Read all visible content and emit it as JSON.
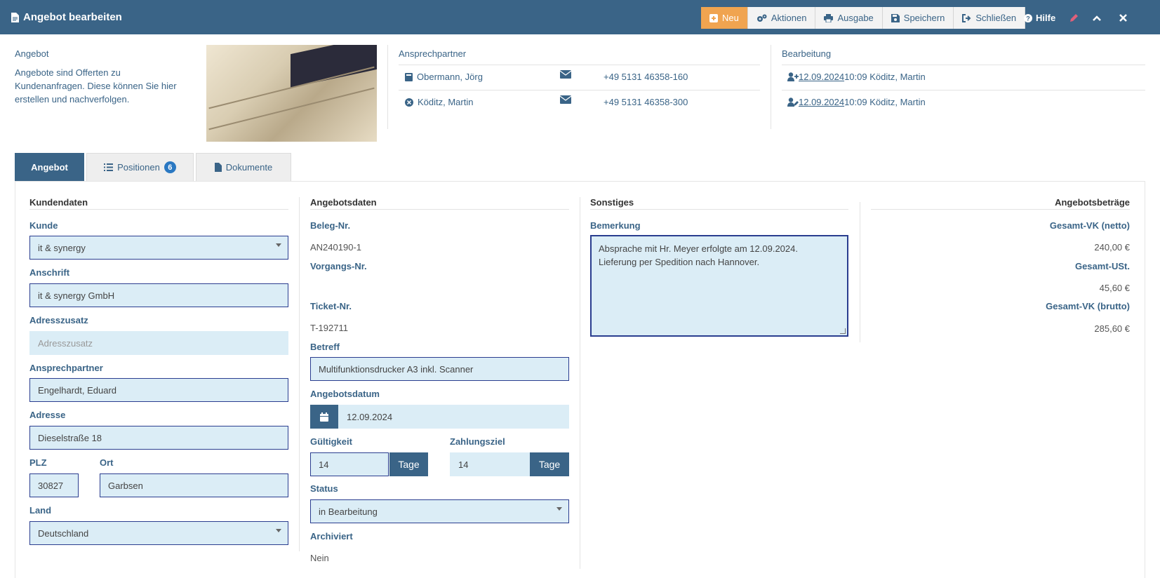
{
  "window": {
    "title": "Angebot bearbeiten"
  },
  "toolbar": {
    "new_label": "Neu",
    "actions_label": "Aktionen",
    "output_label": "Ausgabe",
    "save_label": "Speichern",
    "close_label": "Schließen",
    "help_label": "Hilfe"
  },
  "header": {
    "offer_label": "Angebot",
    "description": "Angebote sind Offerten zu Kundenanfragen. Diese können Sie hier erstellen und nachverfolgen.",
    "contacts_label": "Ansprechpartner",
    "contacts": [
      {
        "name": "Obermann, Jörg",
        "phone": "+49 5131 46358-160"
      },
      {
        "name": "Köditz, Martin",
        "phone": "+49 5131 46358-300"
      }
    ],
    "editing_label": "Bearbeitung",
    "editing": [
      {
        "date": " 12.09.2024 ",
        "info": "10:09 Köditz, Martin"
      },
      {
        "date": " 12.09.2024 ",
        "info": "10:09 Köditz, Martin"
      }
    ]
  },
  "tabs": [
    {
      "label": "Angebot"
    },
    {
      "label": "Positionen",
      "badge": "6"
    },
    {
      "label": "Dokumente"
    }
  ],
  "kunde": {
    "title": "Kundendaten",
    "kunde_label": "Kunde",
    "kunde_value": "it & synergy",
    "anschrift_label": "Anschrift",
    "anschrift_value": "it & synergy GmbH",
    "adresszusatz_label": "Adresszusatz",
    "adresszusatz_placeholder": "Adresszusatz",
    "ansprechpartner_label": "Ansprechpartner",
    "ansprechpartner_value": "Engelhardt, Eduard",
    "adresse_label": "Adresse",
    "adresse_value": "Dieselstraße 18",
    "plz_label": "PLZ",
    "plz_value": "30827",
    "ort_label": "Ort",
    "ort_value": "Garbsen",
    "land_label": "Land",
    "land_value": "Deutschland"
  },
  "angebot": {
    "title": "Angebotsdaten",
    "beleg_label": "Beleg-Nr.",
    "beleg_value": "AN240190-1",
    "vorgang_label": "Vorgangs-Nr.",
    "ticket_label": "Ticket-Nr.",
    "ticket_value": "T-192711",
    "betreff_label": "Betreff",
    "betreff_value": "Multifunktionsdrucker A3 inkl. Scanner",
    "datum_label": "Angebotsdatum",
    "datum_value": "12.09.2024",
    "gueltigkeit_label": "Gültigkeit",
    "gueltigkeit_value": "14",
    "gueltigkeit_unit": "Tage",
    "zahlungsziel_label": "Zahlungsziel",
    "zahlungsziel_value": "14",
    "zahlungsziel_unit": "Tage",
    "status_label": "Status",
    "status_value": "in Bearbeitung",
    "archiviert_label": "Archiviert",
    "archiviert_value": "Nein"
  },
  "sonstiges": {
    "title": "Sonstiges",
    "bemerkung_label": "Bemerkung",
    "bemerkung_line1": "Absprache mit Hr. Meyer erfolgte am 12.09.2024.",
    "bemerkung_line2": "Lieferung per Spedition nach Hannover."
  },
  "betraege": {
    "title": "Angebotsbeträge",
    "netto_label": "Gesamt-VK (netto)",
    "netto_value": "240,00 €",
    "ust_label": "Gesamt-USt.",
    "ust_value": "45,60 €",
    "brutto_label": "Gesamt-VK (brutto)",
    "brutto_value": "285,60 €"
  },
  "colors": {
    "primary": "#3a6487",
    "accent_new": "#f0a450",
    "input_bg": "#dbedf6",
    "badge": "#2a78c2"
  }
}
